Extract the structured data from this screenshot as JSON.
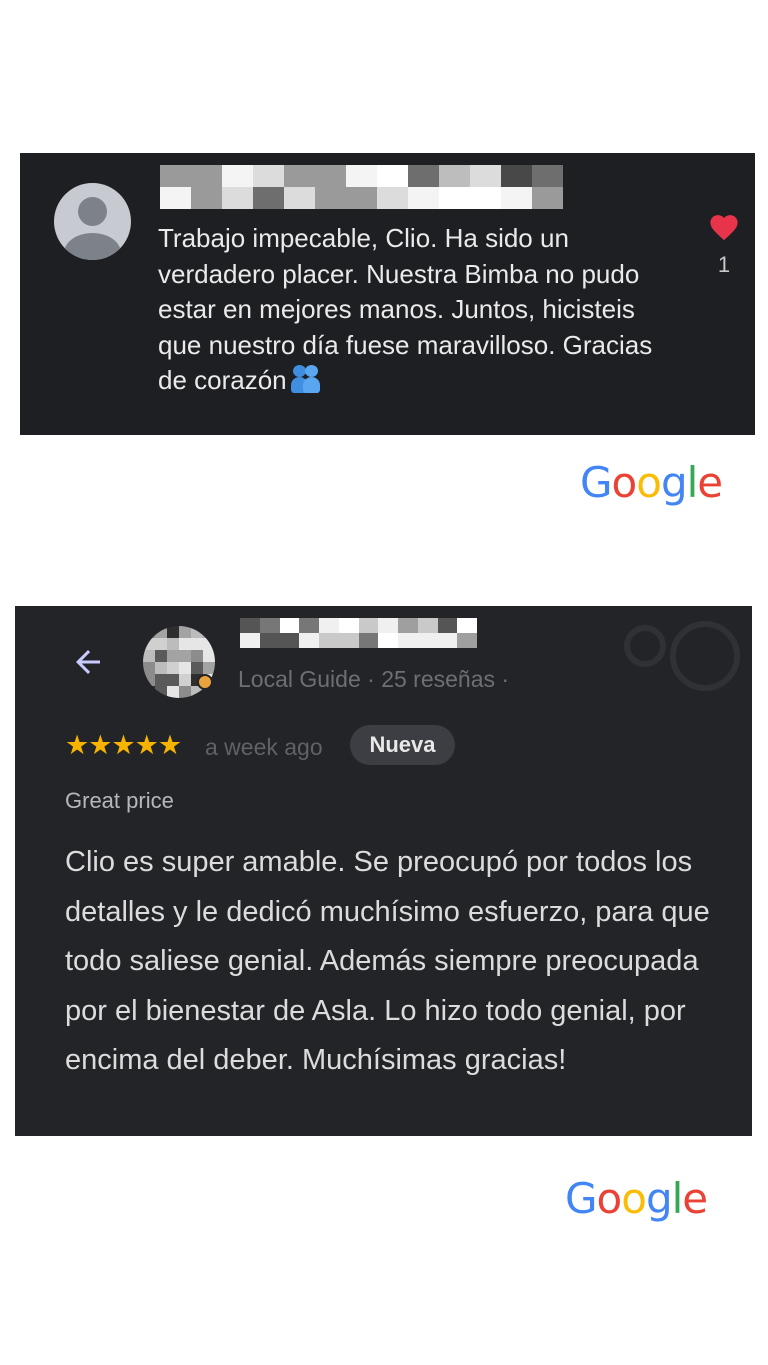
{
  "review1": {
    "text": "Trabajo impecable, Clio. Ha sido un verdadero placer. Nuestra Bimba no pudo estar en mejores manos. Juntos, hicisteis que nuestro día fuese maravilloso. Gracias de corazón",
    "emoji": "people-hugging-emoji",
    "like_count": "1",
    "icons": {
      "avatar": "default-avatar-icon",
      "like": "heart-icon"
    }
  },
  "google_logo": {
    "letters": [
      "G",
      "o",
      "o",
      "g",
      "l",
      "e"
    ],
    "colors": [
      "#4285f4",
      "#ea4335",
      "#fbbc05",
      "#4285f4",
      "#34a853",
      "#ea4335"
    ]
  },
  "review2": {
    "meta": "Local Guide · 25 reseñas ·",
    "stars": "★★★★★",
    "rating": 5,
    "time": "a week ago",
    "badge": "Nueva",
    "subtitle": "Great price",
    "text": "Clio es super amable. Se preocupó por todos los detalles y le dedicó muchísimo esfuerzo, para que todo saliese genial. Además siempre preocupada por el bienestar de Asla. Lo hizo todo genial, por encima del deber. Muchísimas gracias!",
    "icons": {
      "back": "back-arrow-icon",
      "avatar": "pixelated-avatar"
    }
  },
  "colors": {
    "card1_bg": "#1e1f23",
    "card2_bg": "#232427",
    "like": "#e8344a",
    "stars": "#f6b400"
  }
}
